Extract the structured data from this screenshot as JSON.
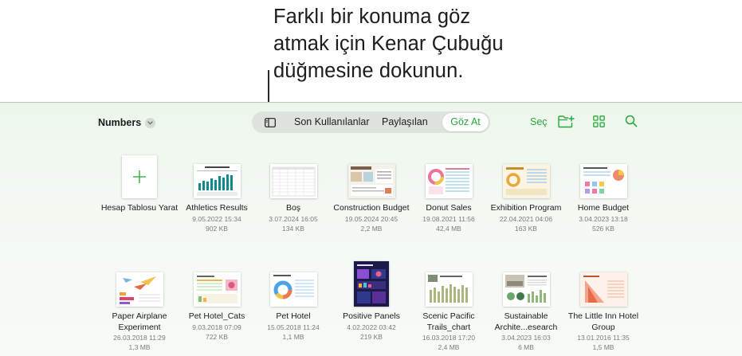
{
  "callout": {
    "lines": [
      "Farklı bir konuma göz",
      "atmak için Kenar Çubuğu",
      "düğmesine dokunun."
    ]
  },
  "toolbar": {
    "title": "Numbers",
    "tabs": {
      "recents": "Son Kullanılanlar",
      "shared": "Paylaşılan",
      "browse": "Göz At"
    },
    "select": "Seç",
    "accent": "#27a83d"
  },
  "row1": [
    {
      "name": "Hesap Tablosu Yarat",
      "date": "",
      "size": ""
    },
    {
      "name": "Athletics Results",
      "date": "9.05.2022 15:34",
      "size": "902 KB"
    },
    {
      "name": "Boş",
      "date": "3.07.2024 16:05",
      "size": "134 KB"
    },
    {
      "name": "Construction Budget",
      "date": "19.05.2024 20:45",
      "size": "2,2 MB"
    },
    {
      "name": "Donut Sales",
      "date": "19.08.2021 11:56",
      "size": "42,4 MB"
    },
    {
      "name": "Exhibition Program",
      "date": "22.04.2021 04:06",
      "size": "163 KB"
    },
    {
      "name": "Home Budget",
      "date": "3.04.2023 13:18",
      "size": "526 KB"
    }
  ],
  "row2": [
    {
      "name": "Paper Airplane Experiment",
      "date": "26.03.2018 11:29",
      "size": "1,3 MB"
    },
    {
      "name": "Pet Hotel_Cats",
      "date": "9.03.2018 07:09",
      "size": "722 KB"
    },
    {
      "name": "Pet Hotel",
      "date": "15.05.2018 11:24",
      "size": "1,1 MB"
    },
    {
      "name": "Positive Panels",
      "date": "4.02.2022 03:42",
      "size": "219 KB"
    },
    {
      "name": "Scenic Pacific Trails_chart",
      "date": "16.03.2018 17:20",
      "size": "2,4 MB"
    },
    {
      "name": "Sustainable Archite...esearch",
      "date": "3.04.2023 16:03",
      "size": "6 MB"
    },
    {
      "name": "The Little Inn Hotel Group",
      "date": "13.01.2016 11:35",
      "size": "1,5 MB"
    }
  ]
}
